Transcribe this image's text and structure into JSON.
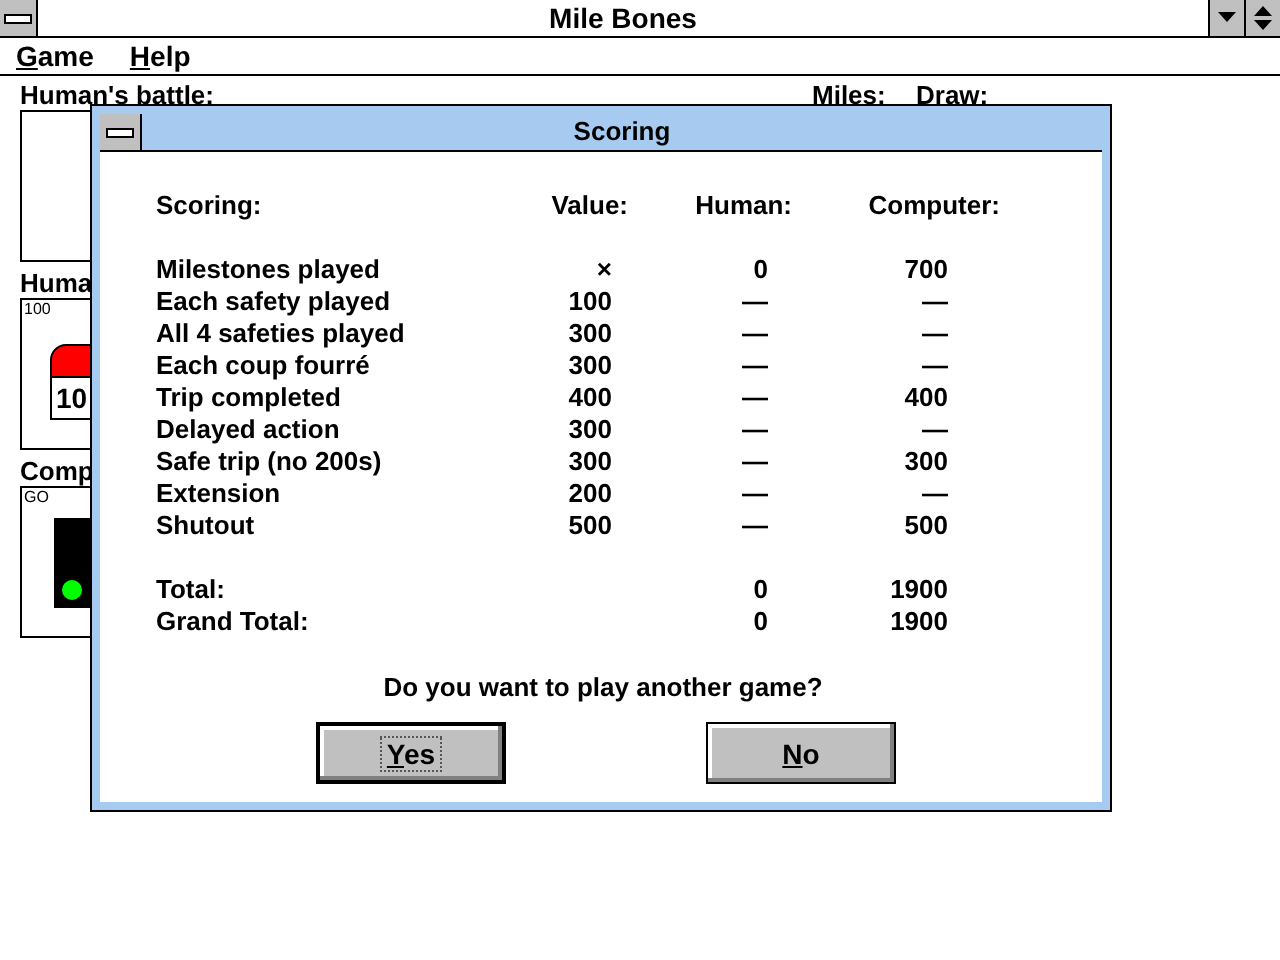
{
  "window": {
    "title": "Mile Bones"
  },
  "menu": [
    {
      "label": "Game"
    },
    {
      "label": "Help"
    }
  ],
  "board": {
    "human_battle_label": "Human's battle:",
    "miles_label": "Miles:",
    "draw_label": "Draw:",
    "human_label": "Huma",
    "human_card_corner": "100",
    "human_card_value": "10",
    "computer_label": "Comp",
    "computer_card_corner": "GO"
  },
  "dialog": {
    "title": "Scoring",
    "columns": [
      "Scoring:",
      "Value:",
      "Human:",
      "Computer:"
    ],
    "rows": [
      [
        "Milestones played",
        "×",
        "0",
        "700"
      ],
      [
        "Each safety played",
        "100",
        "—",
        "—"
      ],
      [
        "All 4 safeties played",
        "300",
        "—",
        "—"
      ],
      [
        "Each coup fourré",
        "300",
        "—",
        "—"
      ],
      [
        "Trip completed",
        "400",
        "—",
        "400"
      ],
      [
        "Delayed action",
        "300",
        "—",
        "—"
      ],
      [
        "Safe trip (no 200s)",
        "300",
        "—",
        "300"
      ],
      [
        "Extension",
        "200",
        "—",
        "—"
      ],
      [
        "Shutout",
        "500",
        "—",
        "500"
      ]
    ],
    "totals": [
      [
        "Total:",
        "0",
        "1900"
      ],
      [
        "Grand Total:",
        "0",
        "1900"
      ]
    ],
    "question": "Do you want to play another game?",
    "buttons": [
      {
        "label": "Yes",
        "default": true
      },
      {
        "label": "No",
        "default": false
      }
    ]
  }
}
